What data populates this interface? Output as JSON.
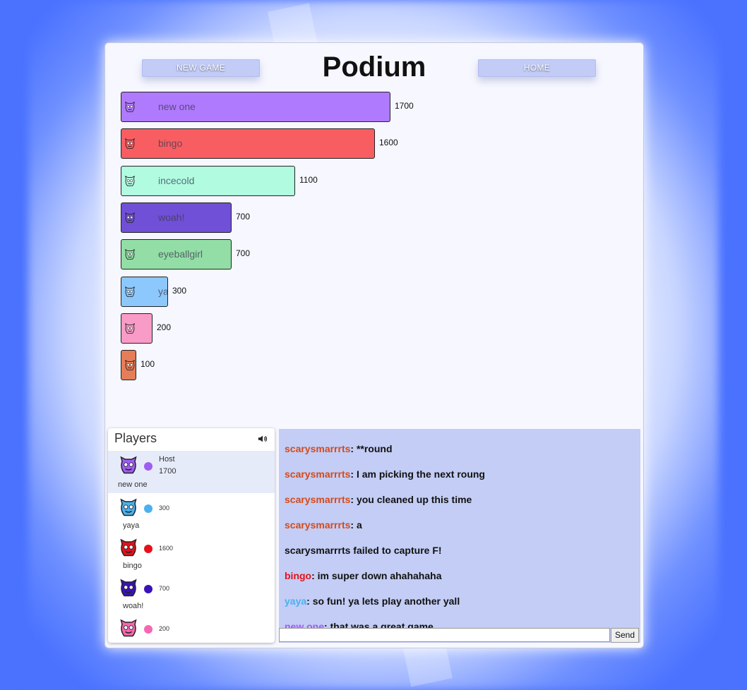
{
  "header": {
    "title": "Podium",
    "new_game_label": "NEW GAME",
    "home_label": "HOME"
  },
  "podium": [
    {
      "name": "new one",
      "score": "1700",
      "value": 1700,
      "color": "#b07aff",
      "avatar": "purple-cat-icon"
    },
    {
      "name": "bingo",
      "score": "1600",
      "value": 1600,
      "color": "#f85d62",
      "avatar": "red-devil-icon"
    },
    {
      "name": "incecold",
      "score": "1100",
      "value": 1100,
      "color": "#b1fbe1",
      "avatar": "ice-ghost-icon"
    },
    {
      "name": "woah!",
      "score": "700",
      "value": 700,
      "color": "#7050d6",
      "avatar": "violet-monster-icon"
    },
    {
      "name": "eyeballgirl",
      "score": "700",
      "value": 700,
      "color": "#92dea6",
      "avatar": "eyeball-icon"
    },
    {
      "name": "yaya",
      "score": "300",
      "value": 300,
      "color": "#8cc8fb",
      "avatar": "blue-robot-icon"
    },
    {
      "name": "",
      "score": "200",
      "value": 200,
      "color": "#f99bc7",
      "avatar": "pink-creature-icon"
    },
    {
      "name": "",
      "score": "100",
      "value": 100,
      "color": "#e57d58",
      "avatar": "orange-bear-icon"
    }
  ],
  "players_panel": {
    "title": "Players",
    "players": [
      {
        "name": "new one",
        "role": "Host",
        "points": "1700",
        "color": "#9f5cf5",
        "avatar": "purple-cat-icon"
      },
      {
        "name": "yaya",
        "role": "",
        "points": "300",
        "color": "#4ab1ef",
        "avatar": "blue-robot-icon"
      },
      {
        "name": "bingo",
        "role": "",
        "points": "1600",
        "color": "#e5111a",
        "avatar": "red-devil-icon"
      },
      {
        "name": "woah!",
        "role": "",
        "points": "700",
        "color": "#3a12b8",
        "avatar": "violet-monster-icon"
      },
      {
        "name": "",
        "role": "",
        "points": "200",
        "color": "#f766b1",
        "avatar": "pink-creature-icon"
      }
    ]
  },
  "chat": {
    "messages": [
      {
        "user": "scarysmarrrts",
        "text": ": **round",
        "color": "#d54a1b"
      },
      {
        "user": "scarysmarrrts",
        "text": ": I am picking the next roung",
        "color": "#d54a1b"
      },
      {
        "user": "scarysmarrrts",
        "text": ": you cleaned up this time",
        "color": "#d54a1b"
      },
      {
        "user": "scarysmarrrts",
        "text": ": a",
        "color": "#d54a1b"
      },
      {
        "user": "",
        "text": "scarysmarrrts failed to capture F!",
        "color": "#111111"
      },
      {
        "user": "bingo",
        "text": ": im super down ahahahaha",
        "color": "#e5111a"
      },
      {
        "user": "yaya",
        "text": ": so fun! ya lets play another yall",
        "color": "#4ab1ef"
      },
      {
        "user": "new one",
        "text": ": that was a great game",
        "color": "#9f5cf5"
      }
    ],
    "input_value": "",
    "send_label": "Send"
  }
}
